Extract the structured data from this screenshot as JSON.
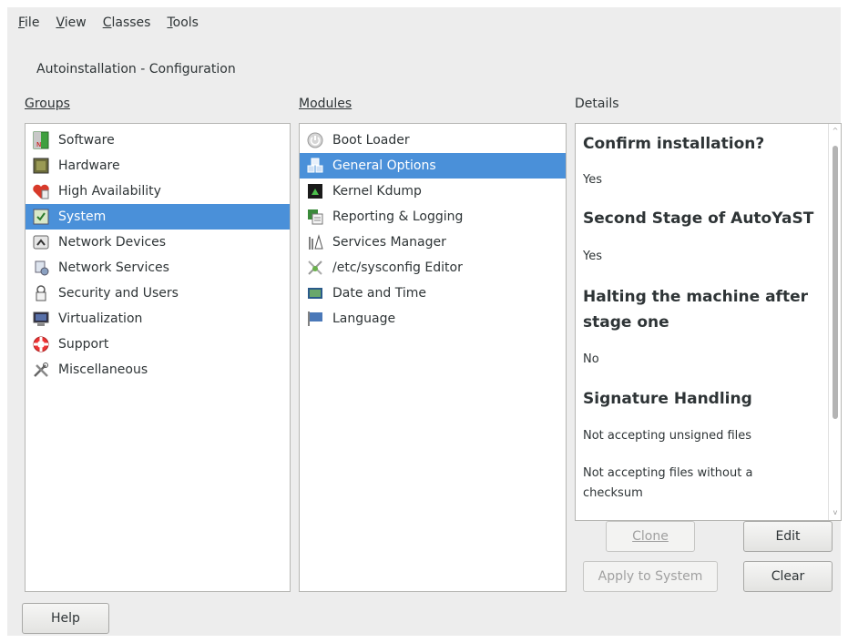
{
  "menu": [
    {
      "u": "F",
      "rest": "ile"
    },
    {
      "u": "V",
      "rest": "iew"
    },
    {
      "u": "C",
      "rest": "lasses"
    },
    {
      "u": "T",
      "rest": "ools"
    }
  ],
  "dialog_title": "Autoinstallation - Configuration",
  "groups": {
    "label": "Groups",
    "items": [
      "Software",
      "Hardware",
      "High Availability",
      "System",
      "Network Devices",
      "Network Services",
      "Security and Users",
      "Virtualization",
      "Support",
      "Miscellaneous"
    ],
    "selected": "System"
  },
  "modules": {
    "label": "Modules",
    "items": [
      "Boot Loader",
      "General Options",
      "Kernel Kdump",
      "Reporting & Logging",
      "Services Manager",
      "/etc/sysconfig Editor",
      "Date and Time",
      "Language"
    ],
    "selected": "General Options"
  },
  "details": {
    "label": "Details",
    "h1": "Confirm installation?",
    "t1": "Yes",
    "h2": "Second Stage of AutoYaST",
    "t2": "Yes",
    "h3a": "Halting the machine after",
    "h3b": "stage one",
    "t3": "No",
    "h4": "Signature Handling",
    "t4": "Not accepting unsigned files",
    "t5a": "Not accepting files without a",
    "t5b": "checksum"
  },
  "buttons": {
    "clone": "Clone",
    "edit": "Edit",
    "apply": "Apply to System",
    "clear": "Clear",
    "help": "Help"
  },
  "colors": {
    "selection": "#4a90d9"
  }
}
